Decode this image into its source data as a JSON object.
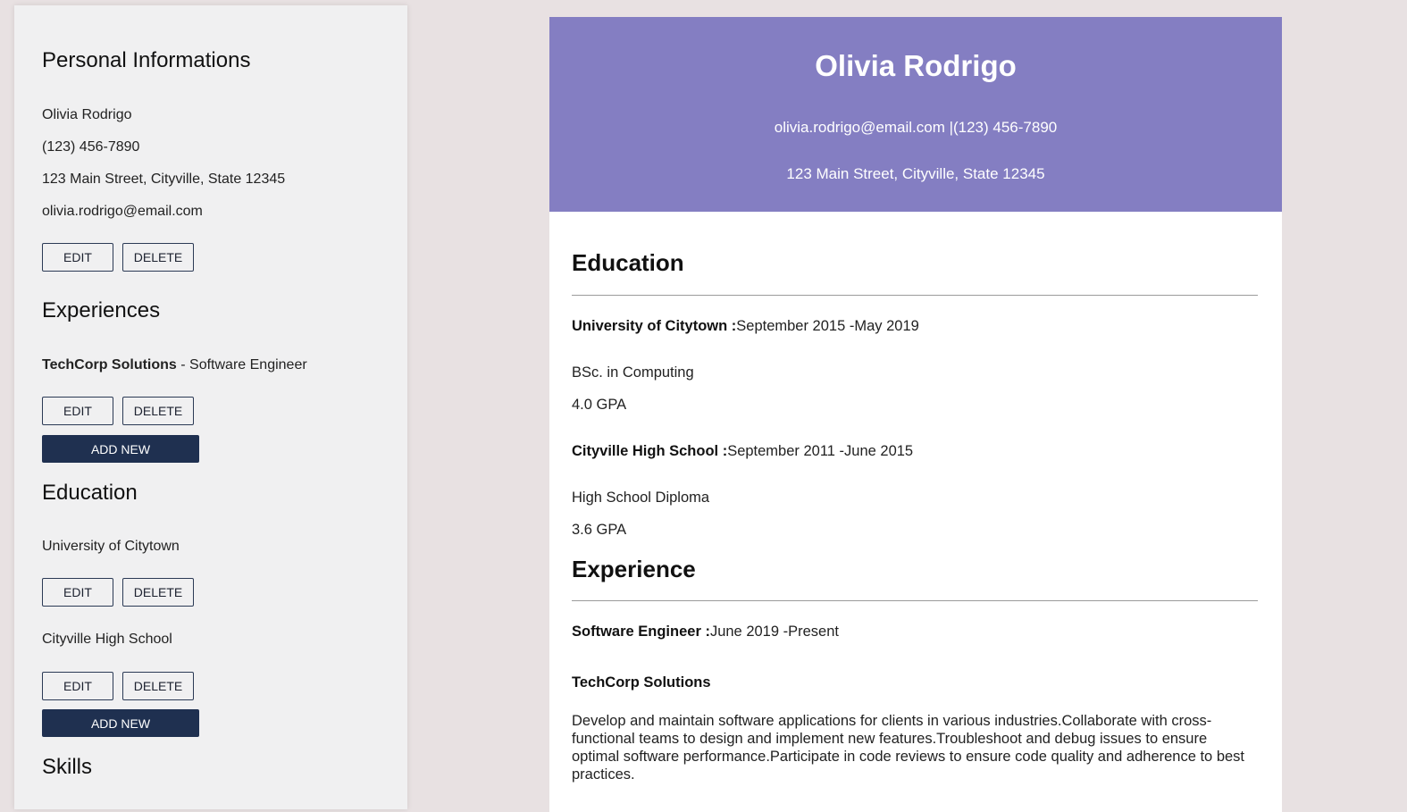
{
  "sidebar": {
    "personal": {
      "heading": "Personal Informations",
      "name": "Olivia Rodrigo",
      "phone": "(123) 456-7890",
      "address": "123 Main Street, Cityville, State 12345",
      "email": "olivia.rodrigo@email.com",
      "edit_label": "EDIT",
      "delete_label": "DELETE"
    },
    "experiences": {
      "heading": "Experiences",
      "items": [
        {
          "company": "TechCorp Solutions",
          "separator": " - ",
          "title": "Software Engineer",
          "edit_label": "EDIT",
          "delete_label": "DELETE"
        }
      ],
      "add_label": "ADD NEW"
    },
    "education": {
      "heading": "Education",
      "items": [
        {
          "school": "University of Citytown",
          "edit_label": "EDIT",
          "delete_label": "DELETE"
        },
        {
          "school": "Cityville High School",
          "edit_label": "EDIT",
          "delete_label": "DELETE"
        }
      ],
      "add_label": "ADD NEW"
    },
    "skills": {
      "heading": "Skills"
    }
  },
  "resume": {
    "header": {
      "name": "Olivia Rodrigo",
      "contact": "olivia.rodrigo@email.com |(123) 456-7890",
      "address": "123 Main Street, Cityville, State 12345",
      "bg_color": "#847ec2"
    },
    "education": {
      "title": "Education",
      "items": [
        {
          "school": "University of Citytown :",
          "dates": "September 2015 -May 2019",
          "degree": "BSc. in Computing",
          "gpa": "4.0 GPA"
        },
        {
          "school": "Cityville High School :",
          "dates": "September 2011 -June 2015",
          "degree": "High School Diploma",
          "gpa": "3.6 GPA"
        }
      ]
    },
    "experience": {
      "title": "Experience",
      "items": [
        {
          "role": "Software Engineer :",
          "dates": "June 2019 -Present",
          "company": "TechCorp Solutions",
          "description": "Develop and maintain software applications for clients in various industries.Collaborate with cross-functional teams to design and implement new features.Troubleshoot and debug issues to ensure optimal software performance.Participate in code reviews to ensure code quality and adherence to best practices."
        }
      ]
    }
  },
  "colors": {
    "primary_button": "#1f3050",
    "page_bg": "#e8e1e2",
    "sidebar_bg": "#f0f0f1"
  }
}
